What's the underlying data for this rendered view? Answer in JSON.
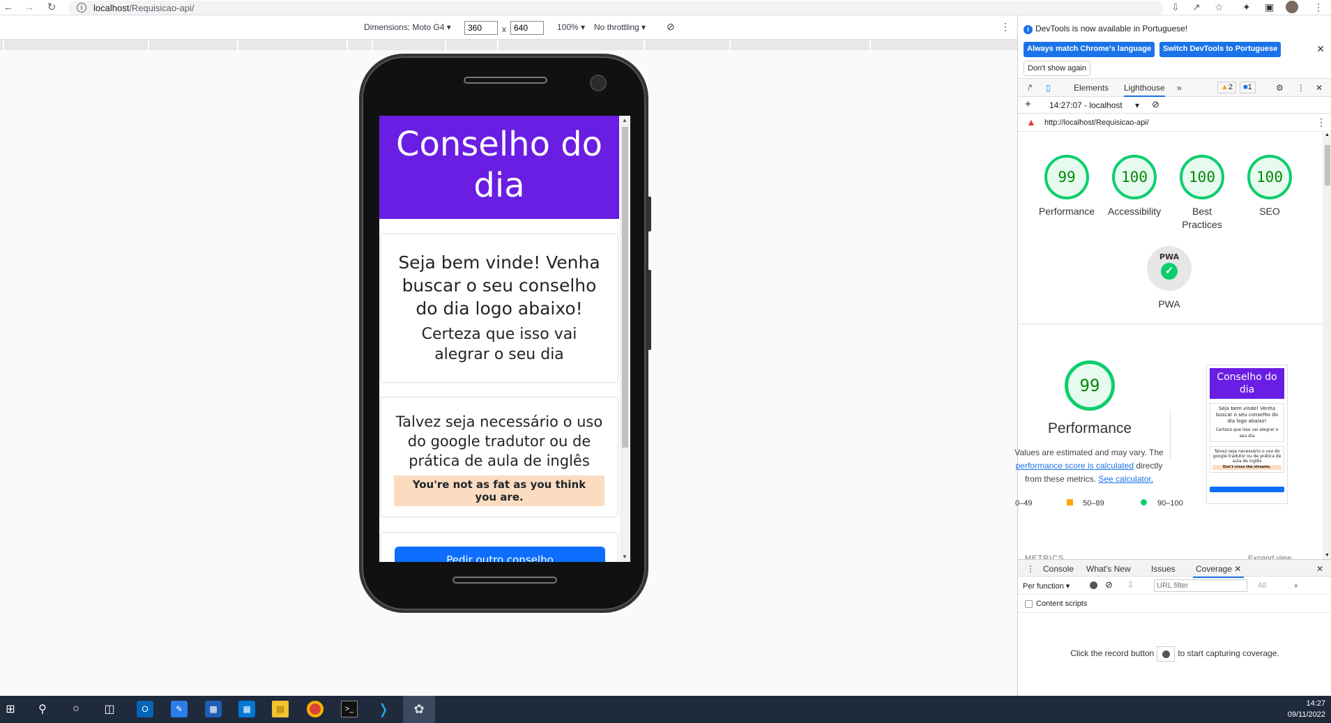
{
  "browser": {
    "url_host": "localhost",
    "url_path": "/Requisicao-api/"
  },
  "device_toolbar": {
    "dimensions_label": "Dimensions: Moto G4",
    "width": "360",
    "height": "640",
    "times": "x",
    "zoom": "100%",
    "throttling": "No throttling"
  },
  "page": {
    "header_title": "Conselho do dia",
    "welcome_text": "Seja bem vinde! Venha buscar o seu conselho do dia logo abaixo!",
    "welcome_sub": "Certeza que isso vai alegrar o seu dia",
    "tip_text": "Talvez seja necessário o uso do google tradutor ou de prática de aula de inglês",
    "advice": "You're not as fat as you think you are.",
    "button_label": "Pedir outro conselho"
  },
  "devtools": {
    "info_message": "DevTools is now available in Portuguese!",
    "btn_match": "Always match Chrome's language",
    "btn_switch": "Switch DevTools to Portuguese",
    "btn_dont_show": "Don't show again",
    "tabs": [
      "Elements",
      "Lighthouse"
    ],
    "warnings_count": "2",
    "messages_count": "1",
    "report_time": "14:27:07 - localhost",
    "report_url": "http://localhost/Requisicao-api/",
    "scores": [
      {
        "value": "99",
        "label": "Performance"
      },
      {
        "value": "100",
        "label": "Accessibility"
      },
      {
        "value": "100",
        "label": "Best Practices"
      },
      {
        "value": "100",
        "label": "SEO"
      }
    ],
    "pwa_label": "PWA",
    "pwa_badge": "PWA",
    "perf_score": "99",
    "perf_title": "Performance",
    "perf_desc_1": "Values are estimated and may vary. The",
    "perf_desc_link": "performance score is calculated",
    "perf_desc_2": "directly from these metrics.",
    "perf_desc_calc": "See calculator.",
    "legend_low": "0–49",
    "legend_mid": "50–89",
    "legend_high": "90–100",
    "thumb_title": "Conselho do dia",
    "thumb_welcome": "Seja bem vinde! Venha buscar o seu conselho do dia logo abaixo!",
    "thumb_sub": "Certeza que isso vai alegrar o seu dia",
    "thumb_tip": "Talvez seja necessário o uso do google tradutor ou de prática de aula de inglês",
    "thumb_advice": "Don't cross the streams.",
    "metrics_heading": "METRICS",
    "expand_view": "Expand view"
  },
  "drawer": {
    "tabs": [
      "Console",
      "What's New",
      "Issues",
      "Coverage"
    ],
    "per_function": "Per function",
    "url_filter_placeholder": "URL filter",
    "all_option": "All",
    "content_scripts": "Content scripts",
    "hint_before": "Click the record button",
    "hint_after": "to start capturing coverage."
  },
  "taskbar": {
    "time": "14:27",
    "date": "09/11/2022"
  },
  "colors": {
    "header_purple": "#6a1de3",
    "button_blue": "#0d6efd",
    "advice_bg": "#fbdcc1",
    "score_green": "#0cce6b"
  }
}
